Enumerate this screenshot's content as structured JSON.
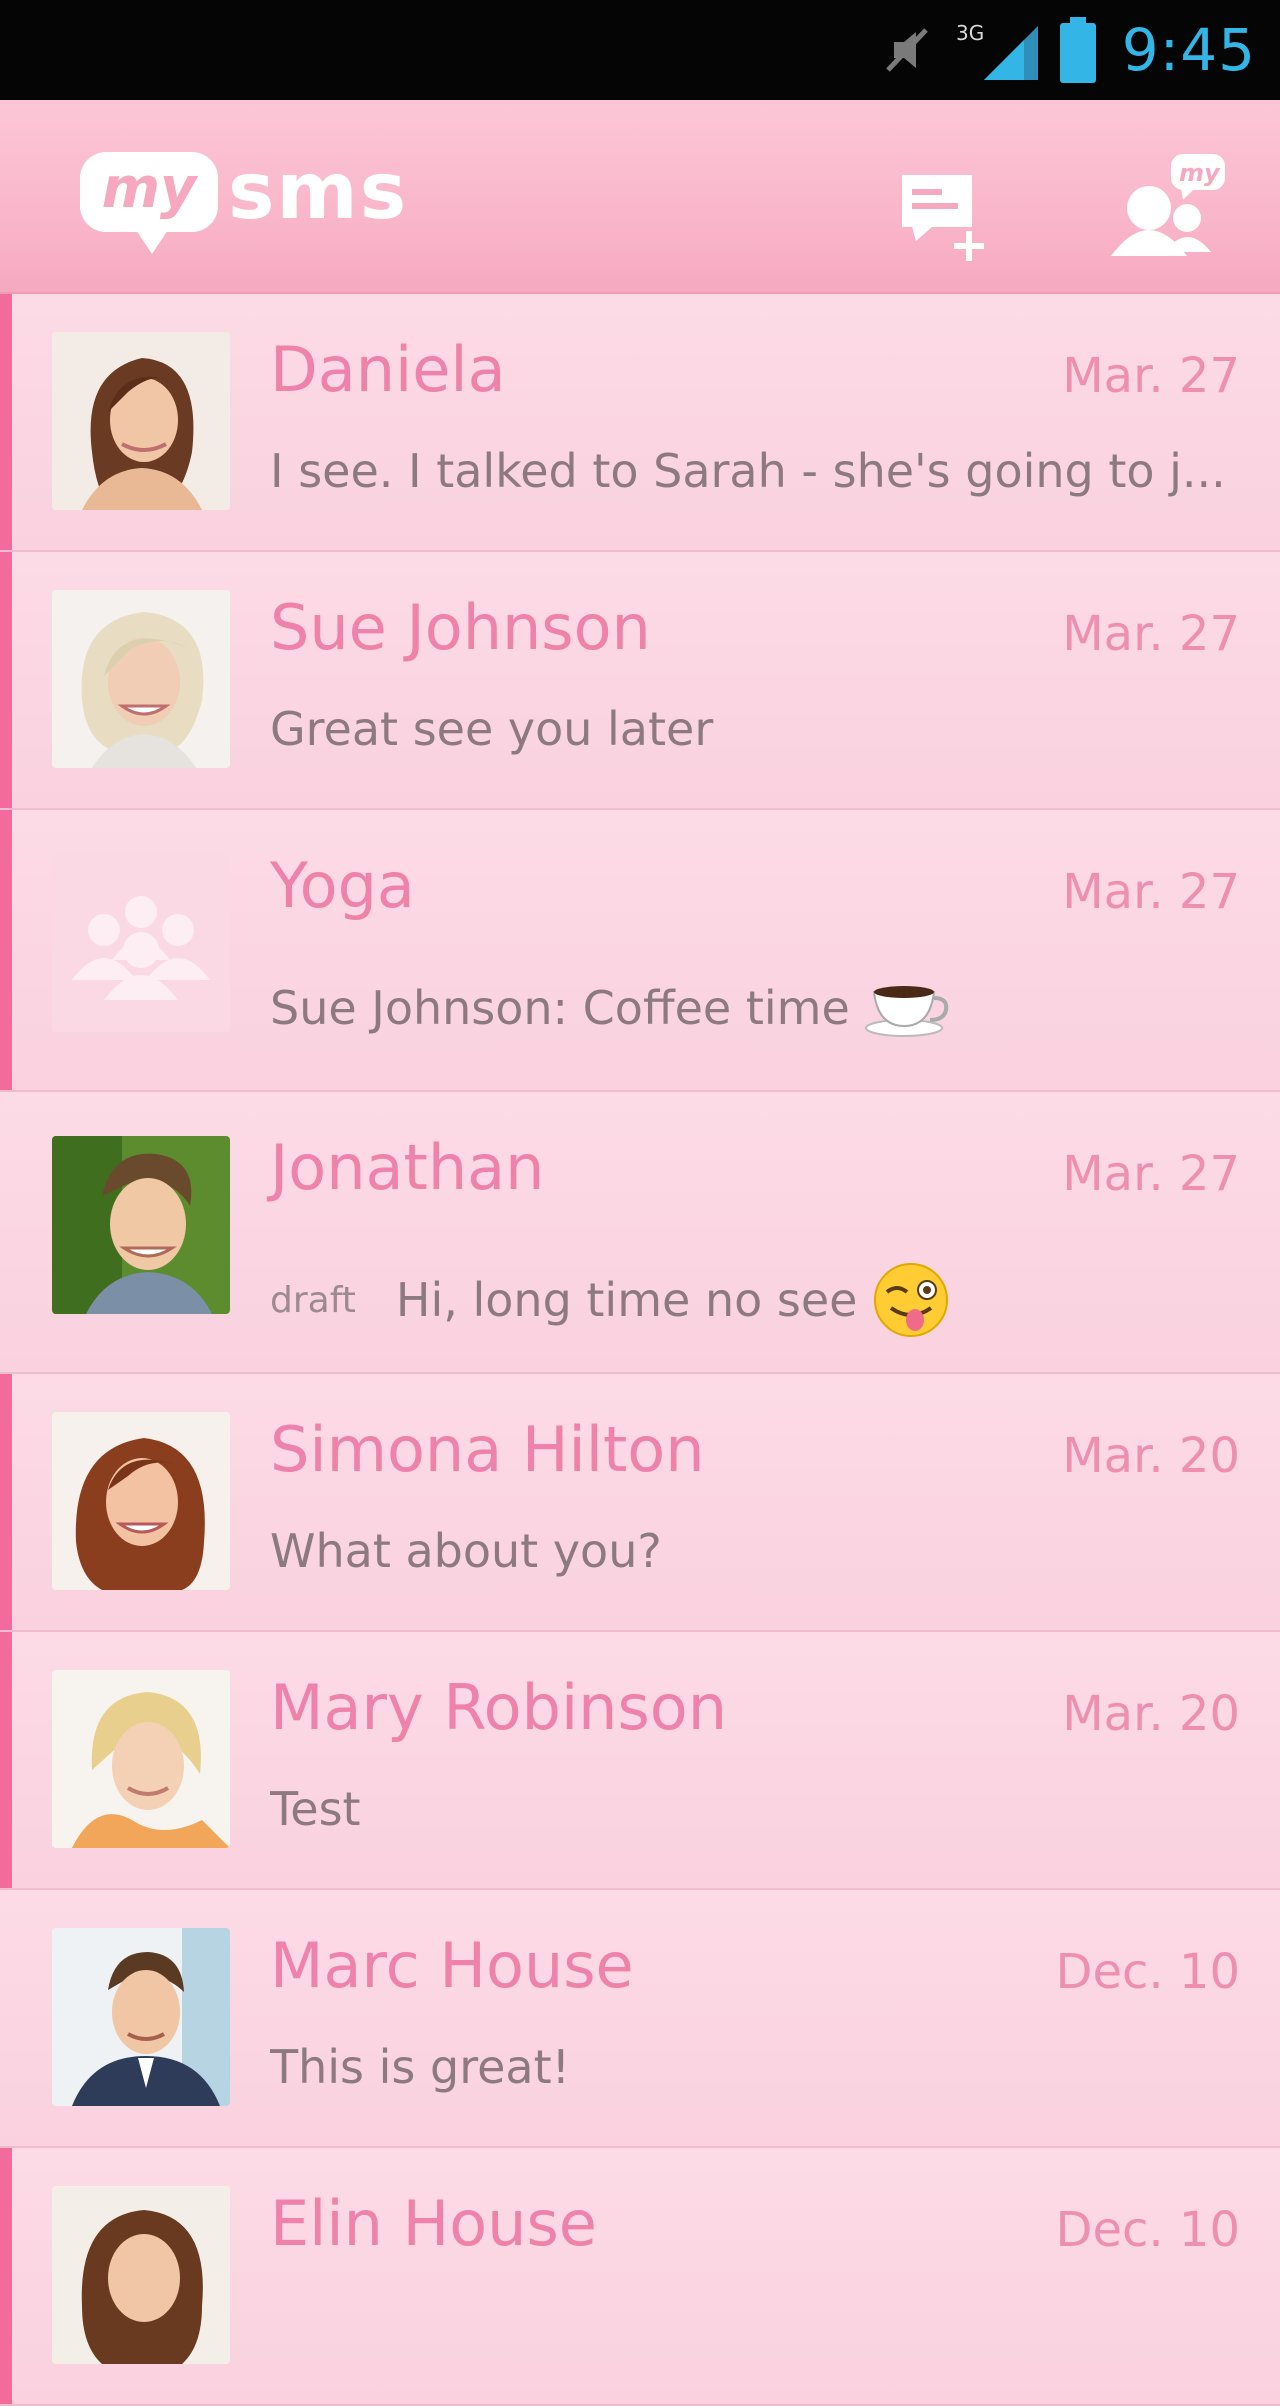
{
  "status_bar": {
    "network": "3G",
    "time": "9:45",
    "icons": [
      "mute-icon",
      "signal-icon",
      "battery-icon"
    ]
  },
  "header": {
    "logo_my": "my",
    "logo_sms": "sms",
    "compose_icon": "new-message-icon",
    "contacts_icon": "my-contacts-icon"
  },
  "colors": {
    "accent": "#f26b9a",
    "name": "#ee82a8",
    "background": "#fbd3e1",
    "status_time": "#33b5e5"
  },
  "conversations": [
    {
      "name": "Daniela",
      "date": "Mar. 27",
      "preview": "I see. I talked to Sarah - she's going to j...",
      "unread": true,
      "avatar": "photo-avatar"
    },
    {
      "name": "Sue Johnson",
      "date": "Mar. 27",
      "preview": "Great see you later",
      "unread": true,
      "avatar": "photo-avatar"
    },
    {
      "name": "Yoga",
      "date": "Mar. 27",
      "preview": "Sue Johnson: Coffee time",
      "unread": true,
      "avatar": "group-avatar-icon",
      "emoji": "coffee-cup-icon"
    },
    {
      "name": "Jonathan",
      "date": "Mar. 27",
      "draft_label": "draft",
      "preview": "Hi, long time no see",
      "unread": false,
      "avatar": "photo-avatar",
      "emoji": "winking-tongue-face-icon"
    },
    {
      "name": "Simona Hilton",
      "date": "Mar. 20",
      "preview": "What about you?",
      "unread": true,
      "avatar": "photo-avatar"
    },
    {
      "name": "Mary Robinson",
      "date": "Mar. 20",
      "preview": "Test",
      "unread": true,
      "avatar": "photo-avatar"
    },
    {
      "name": "Marc House",
      "date": "Dec. 10",
      "preview": "This is great!",
      "unread": false,
      "avatar": "photo-avatar"
    },
    {
      "name": "Elin House",
      "date": "Dec. 10",
      "preview": "",
      "unread": true,
      "avatar": "photo-avatar"
    }
  ]
}
